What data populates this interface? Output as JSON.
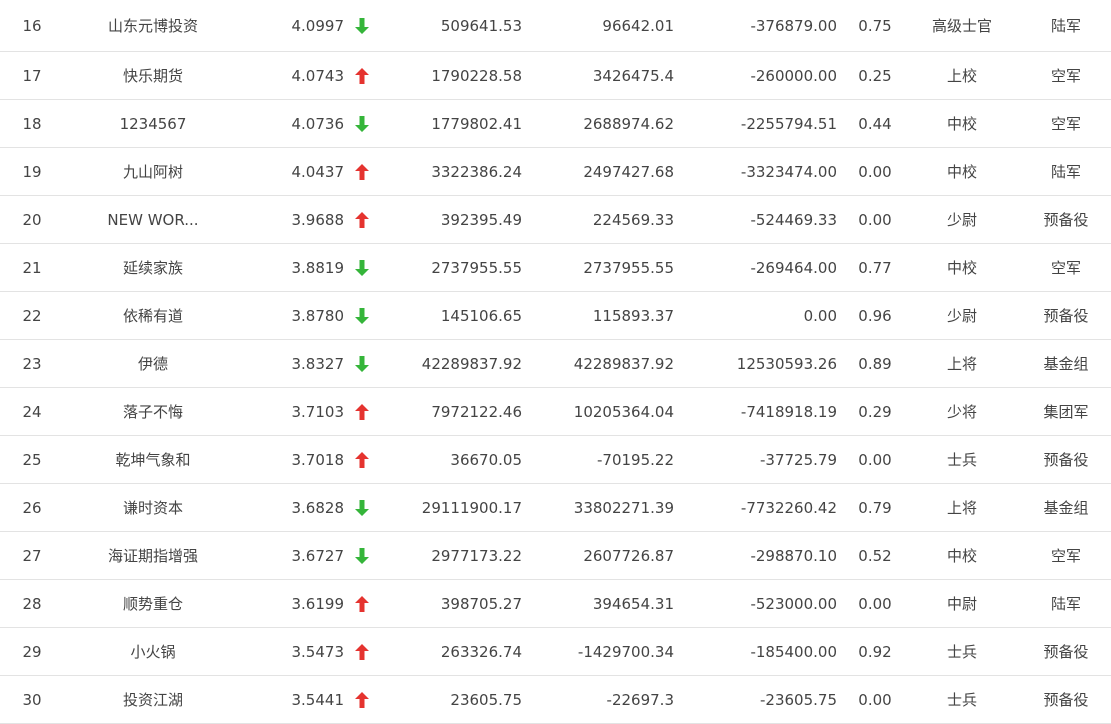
{
  "colors": {
    "up": "#e5332f",
    "down": "#35b53a",
    "text": "#444444",
    "divider": "#e3e3e3"
  },
  "rows": [
    {
      "rank": "16",
      "name": "山东元博投资",
      "score": "4.0997",
      "trend": "down",
      "v1": "509641.53",
      "v2": "96642.01",
      "v3": "-376879.00",
      "ratio": "0.75",
      "title": "高级士官",
      "group": "陆军"
    },
    {
      "rank": "17",
      "name": "快乐期货",
      "score": "4.0743",
      "trend": "up",
      "v1": "1790228.58",
      "v2": "3426475.4",
      "v3": "-260000.00",
      "ratio": "0.25",
      "title": "上校",
      "group": "空军"
    },
    {
      "rank": "18",
      "name": "1234567",
      "score": "4.0736",
      "trend": "down",
      "v1": "1779802.41",
      "v2": "2688974.62",
      "v3": "-2255794.51",
      "ratio": "0.44",
      "title": "中校",
      "group": "空军"
    },
    {
      "rank": "19",
      "name": "九山阿树",
      "score": "4.0437",
      "trend": "up",
      "v1": "3322386.24",
      "v2": "2497427.68",
      "v3": "-3323474.00",
      "ratio": "0.00",
      "title": "中校",
      "group": "陆军"
    },
    {
      "rank": "20",
      "name": "NEW WOR...",
      "score": "3.9688",
      "trend": "up",
      "v1": "392395.49",
      "v2": "224569.33",
      "v3": "-524469.33",
      "ratio": "0.00",
      "title": "少尉",
      "group": "预备役"
    },
    {
      "rank": "21",
      "name": "延续家族",
      "score": "3.8819",
      "trend": "down",
      "v1": "2737955.55",
      "v2": "2737955.55",
      "v3": "-269464.00",
      "ratio": "0.77",
      "title": "中校",
      "group": "空军"
    },
    {
      "rank": "22",
      "name": "依稀有道",
      "score": "3.8780",
      "trend": "down",
      "v1": "145106.65",
      "v2": "115893.37",
      "v3": "0.00",
      "ratio": "0.96",
      "title": "少尉",
      "group": "预备役"
    },
    {
      "rank": "23",
      "name": "伊德",
      "score": "3.8327",
      "trend": "down",
      "v1": "42289837.92",
      "v2": "42289837.92",
      "v3": "12530593.26",
      "ratio": "0.89",
      "title": "上将",
      "group": "基金组"
    },
    {
      "rank": "24",
      "name": "落子不悔",
      "score": "3.7103",
      "trend": "up",
      "v1": "7972122.46",
      "v2": "10205364.04",
      "v3": "-7418918.19",
      "ratio": "0.29",
      "title": "少将",
      "group": "集团军"
    },
    {
      "rank": "25",
      "name": "乾坤气象和",
      "score": "3.7018",
      "trend": "up",
      "v1": "36670.05",
      "v2": "-70195.22",
      "v3": "-37725.79",
      "ratio": "0.00",
      "title": "士兵",
      "group": "预备役"
    },
    {
      "rank": "26",
      "name": "谦时资本",
      "score": "3.6828",
      "trend": "down",
      "v1": "29111900.17",
      "v2": "33802271.39",
      "v3": "-7732260.42",
      "ratio": "0.79",
      "title": "上将",
      "group": "基金组"
    },
    {
      "rank": "27",
      "name": "海证期指增强",
      "score": "3.6727",
      "trend": "down",
      "v1": "2977173.22",
      "v2": "2607726.87",
      "v3": "-298870.10",
      "ratio": "0.52",
      "title": "中校",
      "group": "空军"
    },
    {
      "rank": "28",
      "name": "顺势重仓",
      "score": "3.6199",
      "trend": "up",
      "v1": "398705.27",
      "v2": "394654.31",
      "v3": "-523000.00",
      "ratio": "0.00",
      "title": "中尉",
      "group": "陆军"
    },
    {
      "rank": "29",
      "name": "小火锅",
      "score": "3.5473",
      "trend": "up",
      "v1": "263326.74",
      "v2": "-1429700.34",
      "v3": "-185400.00",
      "ratio": "0.92",
      "title": "士兵",
      "group": "预备役"
    },
    {
      "rank": "30",
      "name": "投资江湖",
      "score": "3.5441",
      "trend": "up",
      "v1": "23605.75",
      "v2": "-22697.3",
      "v3": "-23605.75",
      "ratio": "0.00",
      "title": "士兵",
      "group": "预备役"
    }
  ]
}
